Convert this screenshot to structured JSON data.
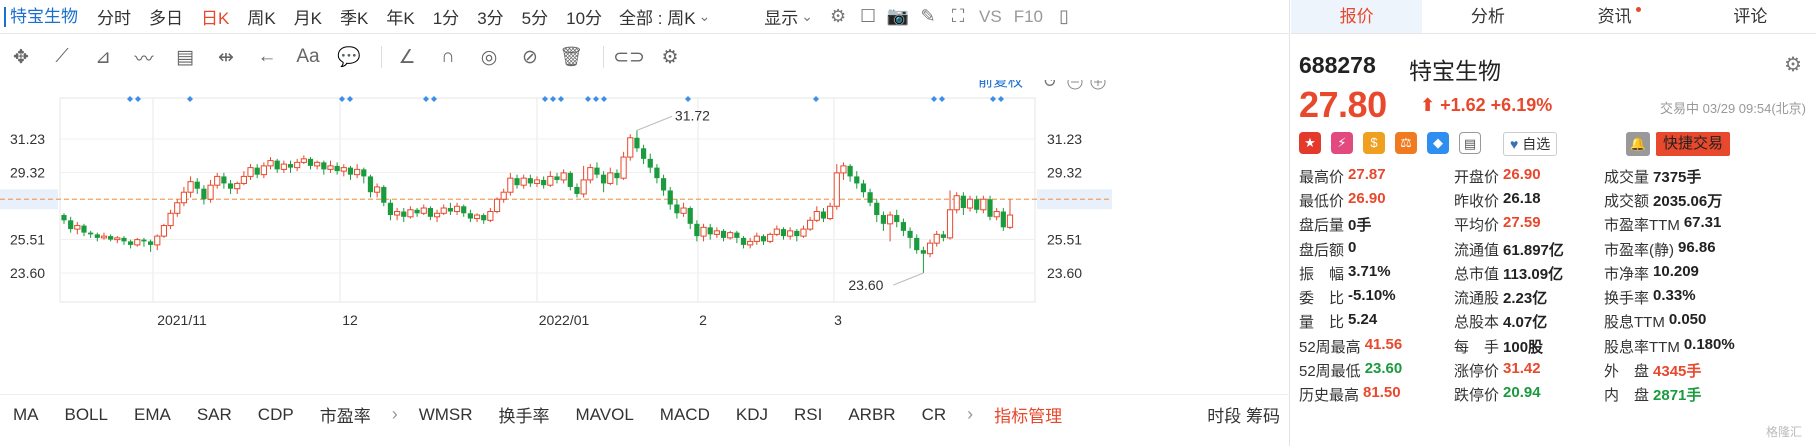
{
  "topbar": {
    "stock_name": "特宝生物",
    "periods": [
      "分时",
      "多日",
      "日K",
      "周K",
      "月K",
      "季K",
      "年K",
      "1分",
      "3分",
      "5分",
      "10分"
    ],
    "active_period": "日K",
    "range_select": "全部 : 周K",
    "display_label": "显示",
    "vs_label": "VS",
    "f10_label": "F10"
  },
  "chart": {
    "adjust_label": "前复权",
    "price_levels": [
      "31.23",
      "29.32",
      "27.80",
      "25.51",
      "23.60"
    ],
    "current_price_label": "27.80",
    "high_annotation": "31.72",
    "low_annotation": "23.60",
    "x_labels": [
      "2021/11",
      "12",
      "2022/01",
      "2",
      "3"
    ],
    "colors": {
      "up": "#e8482c",
      "down": "#1a9b3e",
      "current": "#f0a060",
      "marker": "#3b8fe8"
    }
  },
  "chart_data": {
    "type": "candlestick",
    "yticks": [
      31.23,
      29.32,
      27.8,
      25.51,
      23.6
    ],
    "current": 27.8,
    "candles": [
      [
        26.9,
        26.6,
        27.0,
        26.4
      ],
      [
        26.6,
        26.1,
        26.8,
        25.9
      ],
      [
        26.1,
        26.3,
        26.5,
        25.8
      ],
      [
        26.3,
        25.9,
        26.4,
        25.7
      ],
      [
        25.9,
        25.8,
        26.0,
        25.6
      ],
      [
        25.8,
        25.6,
        25.9,
        25.4
      ],
      [
        25.6,
        25.7,
        25.9,
        25.5
      ],
      [
        25.7,
        25.5,
        25.8,
        25.4
      ],
      [
        25.5,
        25.6,
        25.7,
        25.3
      ],
      [
        25.6,
        25.4,
        25.7,
        25.2
      ],
      [
        25.4,
        25.2,
        25.5,
        25.0
      ],
      [
        25.2,
        25.5,
        25.6,
        25.1
      ],
      [
        25.5,
        25.4,
        25.6,
        25.1
      ],
      [
        25.4,
        25.2,
        25.5,
        24.8
      ],
      [
        25.2,
        25.7,
        25.8,
        24.9
      ],
      [
        25.7,
        26.3,
        26.4,
        25.6
      ],
      [
        26.3,
        27.0,
        27.2,
        26.1
      ],
      [
        27.0,
        27.6,
        27.8,
        26.8
      ],
      [
        27.6,
        28.2,
        28.5,
        27.4
      ],
      [
        28.2,
        28.8,
        29.1,
        27.9
      ],
      [
        28.8,
        28.4,
        29.0,
        28.1
      ],
      [
        28.4,
        27.8,
        28.6,
        27.5
      ],
      [
        27.8,
        28.6,
        28.9,
        27.6
      ],
      [
        28.6,
        29.1,
        29.3,
        28.4
      ],
      [
        29.1,
        28.7,
        29.3,
        28.4
      ],
      [
        28.7,
        28.4,
        28.9,
        28.1
      ],
      [
        28.4,
        28.7,
        28.8,
        28.1
      ],
      [
        28.7,
        29.1,
        29.4,
        28.6
      ],
      [
        29.1,
        29.6,
        29.8,
        28.9
      ],
      [
        29.6,
        29.2,
        29.8,
        29.0
      ],
      [
        29.2,
        29.7,
        29.9,
        29.0
      ],
      [
        29.7,
        30.0,
        30.2,
        29.5
      ],
      [
        30.0,
        29.5,
        30.1,
        29.3
      ],
      [
        29.5,
        29.8,
        30.0,
        29.3
      ],
      [
        29.8,
        29.6,
        30.0,
        29.3
      ],
      [
        29.6,
        29.9,
        30.1,
        29.4
      ],
      [
        29.9,
        30.1,
        30.3,
        29.8
      ],
      [
        30.1,
        29.7,
        30.2,
        29.5
      ],
      [
        29.7,
        29.9,
        30.0,
        29.5
      ],
      [
        29.9,
        29.5,
        30.0,
        29.2
      ],
      [
        29.5,
        29.7,
        30.0,
        29.3
      ],
      [
        29.7,
        29.4,
        29.9,
        29.2
      ],
      [
        29.4,
        29.6,
        29.8,
        29.1
      ],
      [
        29.6,
        29.2,
        29.7,
        28.9
      ],
      [
        29.2,
        29.5,
        29.8,
        29.0
      ],
      [
        29.5,
        29.1,
        29.6,
        28.7
      ],
      [
        29.1,
        28.2,
        29.2,
        27.9
      ],
      [
        28.2,
        28.5,
        28.7,
        27.9
      ],
      [
        28.5,
        27.6,
        28.6,
        27.4
      ],
      [
        27.6,
        26.9,
        27.8,
        26.6
      ],
      [
        26.9,
        27.1,
        27.3,
        26.6
      ],
      [
        27.1,
        26.8,
        27.3,
        26.5
      ],
      [
        26.8,
        27.2,
        27.4,
        26.7
      ],
      [
        27.2,
        27.0,
        27.3,
        26.8
      ],
      [
        27.0,
        27.3,
        27.5,
        26.9
      ],
      [
        27.3,
        26.8,
        27.4,
        26.6
      ],
      [
        26.8,
        27.0,
        27.2,
        26.5
      ],
      [
        27.0,
        27.3,
        27.5,
        26.9
      ],
      [
        27.3,
        27.1,
        27.6,
        26.9
      ],
      [
        27.1,
        27.4,
        27.6,
        26.9
      ],
      [
        27.4,
        27.0,
        27.5,
        26.8
      ],
      [
        27.0,
        26.7,
        27.2,
        26.5
      ],
      [
        26.7,
        26.9,
        27.0,
        26.5
      ],
      [
        26.9,
        26.6,
        27.0,
        26.4
      ],
      [
        26.6,
        27.1,
        27.3,
        26.5
      ],
      [
        27.1,
        27.8,
        27.9,
        27.0
      ],
      [
        27.8,
        28.2,
        28.4,
        27.6
      ],
      [
        28.2,
        29.0,
        29.3,
        28.0
      ],
      [
        29.0,
        28.6,
        29.2,
        28.4
      ],
      [
        28.6,
        29.0,
        29.2,
        28.4
      ],
      [
        29.0,
        28.7,
        29.2,
        28.5
      ],
      [
        28.7,
        28.9,
        29.1,
        28.5
      ],
      [
        28.9,
        28.6,
        29.1,
        28.4
      ],
      [
        28.6,
        29.1,
        29.4,
        28.5
      ],
      [
        29.1,
        28.9,
        29.3,
        28.7
      ],
      [
        28.9,
        29.3,
        29.5,
        28.7
      ],
      [
        29.3,
        28.5,
        29.4,
        28.3
      ],
      [
        28.5,
        28.1,
        28.7,
        27.9
      ],
      [
        28.1,
        28.9,
        29.7,
        27.9
      ],
      [
        28.9,
        29.6,
        29.8,
        28.7
      ],
      [
        29.6,
        29.2,
        29.9,
        29.0
      ],
      [
        29.2,
        28.7,
        29.4,
        28.2
      ],
      [
        28.7,
        29.3,
        29.6,
        28.6
      ],
      [
        29.3,
        29.0,
        29.5,
        28.6
      ],
      [
        29.0,
        30.2,
        30.5,
        28.9
      ],
      [
        30.2,
        31.3,
        31.5,
        30.0
      ],
      [
        31.3,
        30.7,
        31.72,
        30.5
      ],
      [
        30.7,
        30.1,
        30.9,
        29.8
      ],
      [
        30.1,
        29.6,
        30.4,
        29.3
      ],
      [
        29.6,
        29.0,
        29.8,
        28.7
      ],
      [
        29.0,
        28.3,
        29.2,
        28.0
      ],
      [
        28.3,
        27.5,
        28.5,
        27.2
      ],
      [
        27.5,
        27.0,
        27.8,
        26.7
      ],
      [
        27.0,
        27.3,
        27.6,
        26.8
      ],
      [
        27.3,
        26.4,
        27.4,
        26.1
      ],
      [
        26.4,
        25.7,
        26.6,
        25.4
      ],
      [
        25.7,
        26.2,
        26.4,
        25.4
      ],
      [
        26.2,
        25.8,
        26.4,
        25.5
      ],
      [
        25.8,
        26.0,
        26.2,
        25.6
      ],
      [
        26.0,
        25.6,
        26.1,
        25.4
      ],
      [
        25.6,
        25.9,
        26.0,
        25.5
      ],
      [
        25.9,
        25.6,
        26.0,
        25.3
      ],
      [
        25.6,
        25.2,
        25.7,
        25.0
      ],
      [
        25.2,
        25.4,
        25.6,
        25.0
      ],
      [
        25.4,
        25.7,
        25.9,
        25.2
      ],
      [
        25.7,
        25.4,
        25.8,
        25.2
      ],
      [
        25.4,
        25.8,
        25.9,
        25.3
      ],
      [
        25.8,
        26.1,
        26.3,
        25.7
      ],
      [
        26.1,
        25.7,
        26.2,
        25.5
      ],
      [
        25.7,
        26.0,
        26.2,
        25.5
      ],
      [
        26.0,
        25.7,
        26.1,
        25.4
      ],
      [
        25.7,
        26.1,
        26.3,
        25.6
      ],
      [
        26.1,
        26.6,
        26.8,
        26.0
      ],
      [
        26.6,
        27.1,
        27.4,
        26.5
      ],
      [
        27.1,
        26.7,
        27.3,
        26.5
      ],
      [
        26.7,
        27.4,
        27.6,
        26.6
      ],
      [
        27.4,
        29.3,
        29.8,
        27.2
      ],
      [
        29.3,
        29.7,
        29.9,
        28.9
      ],
      [
        29.7,
        29.1,
        29.8,
        28.8
      ],
      [
        29.1,
        28.7,
        29.4,
        28.4
      ],
      [
        28.7,
        28.2,
        28.9,
        27.9
      ],
      [
        28.2,
        27.6,
        28.4,
        27.4
      ],
      [
        27.6,
        26.9,
        27.8,
        26.5
      ],
      [
        26.9,
        26.4,
        27.1,
        26.0
      ],
      [
        26.4,
        26.9,
        27.1,
        25.4
      ],
      [
        26.9,
        26.5,
        27.2,
        26.2
      ],
      [
        26.5,
        26.0,
        26.7,
        25.7
      ],
      [
        26.0,
        25.6,
        26.2,
        25.0
      ],
      [
        25.6,
        24.9,
        25.8,
        24.7
      ],
      [
        24.9,
        24.7,
        25.1,
        23.6
      ],
      [
        24.7,
        25.3,
        25.5,
        24.5
      ],
      [
        25.3,
        25.8,
        26.0,
        25.1
      ],
      [
        25.8,
        25.6,
        26.0,
        25.4
      ],
      [
        25.6,
        27.2,
        28.3,
        25.5
      ],
      [
        27.2,
        28.0,
        28.2,
        27.0
      ],
      [
        28.0,
        27.3,
        28.2,
        26.9
      ],
      [
        27.3,
        27.8,
        28.0,
        27.1
      ],
      [
        27.8,
        27.2,
        28.0,
        27.0
      ],
      [
        27.2,
        27.8,
        28.0,
        27.0
      ],
      [
        27.8,
        26.8,
        28.0,
        26.6
      ],
      [
        26.8,
        27.1,
        27.3,
        26.6
      ],
      [
        27.1,
        26.2,
        27.3,
        26.0
      ],
      [
        26.2,
        26.9,
        27.8,
        26.1
      ]
    ],
    "x_labels": [
      "2021/11",
      "12",
      "2022/01",
      "2",
      "3"
    ],
    "high": 31.72,
    "low": 23.6
  },
  "bottombar": {
    "indicators": [
      "MA",
      "BOLL",
      "EMA",
      "SAR",
      "CDP",
      "市盈率",
      "WMSR",
      "换手率",
      "MAVOL",
      "MACD",
      "KDJ",
      "RSI",
      "ARBR",
      "CR"
    ],
    "manage_label": "指标管理",
    "right_label": "时段 筹码"
  },
  "panel": {
    "tabs": [
      "报价",
      "分析",
      "资讯",
      "评论"
    ],
    "code": "688278",
    "name": "特宝生物",
    "price": "27.80",
    "change": "+1.62",
    "change_pct": "+6.19%",
    "status": "交易中 03/29 09:54(北京)",
    "fav_label": "自选",
    "quick_trade_label": "快捷交易",
    "rows": [
      [
        [
          "最高价",
          "27.87",
          "red"
        ],
        [
          "开盘价",
          "26.90",
          "red"
        ],
        [
          "成交量",
          "7375手",
          "black"
        ]
      ],
      [
        [
          "最低价",
          "26.90",
          "red"
        ],
        [
          "昨收价",
          "26.18",
          "black"
        ],
        [
          "成交额",
          "2035.06万",
          "black"
        ]
      ],
      [
        [
          "盘后量",
          "0手",
          "black"
        ],
        [
          "平均价",
          "27.59",
          "red"
        ],
        [
          "市盈率TTM",
          "67.31",
          "black"
        ]
      ],
      [
        [
          "盘后额",
          "0",
          "black"
        ],
        [
          "流通值",
          "61.897亿",
          "black"
        ],
        [
          "市盈率(静)",
          "96.86",
          "black"
        ]
      ],
      [
        [
          "振　幅",
          "3.71%",
          "black"
        ],
        [
          "总市值",
          "113.09亿",
          "black"
        ],
        [
          "市净率",
          "10.209",
          "black"
        ]
      ],
      [
        [
          "委　比",
          "-5.10%",
          "black"
        ],
        [
          "流通股",
          "2.23亿",
          "black"
        ],
        [
          "换手率",
          "0.33%",
          "black"
        ]
      ],
      [
        [
          "量　比",
          "5.24",
          "black"
        ],
        [
          "总股本",
          "4.07亿",
          "black"
        ],
        [
          "股息TTM",
          "0.050",
          "black"
        ]
      ],
      [
        [
          "52周最高",
          "41.56",
          "red"
        ],
        [
          "每　手",
          "100股",
          "black"
        ],
        [
          "股息率TTM",
          "0.180%",
          "black"
        ]
      ],
      [
        [
          "52周最低",
          "23.60",
          "green"
        ],
        [
          "涨停价",
          "31.42",
          "red"
        ],
        [
          "外　盘",
          "4345手",
          "red"
        ]
      ],
      [
        [
          "历史最高",
          "81.50",
          "red"
        ],
        [
          "跌停价",
          "20.94",
          "green"
        ],
        [
          "内　盘",
          "2871手",
          "green"
        ]
      ]
    ],
    "watermark": "格隆汇"
  }
}
